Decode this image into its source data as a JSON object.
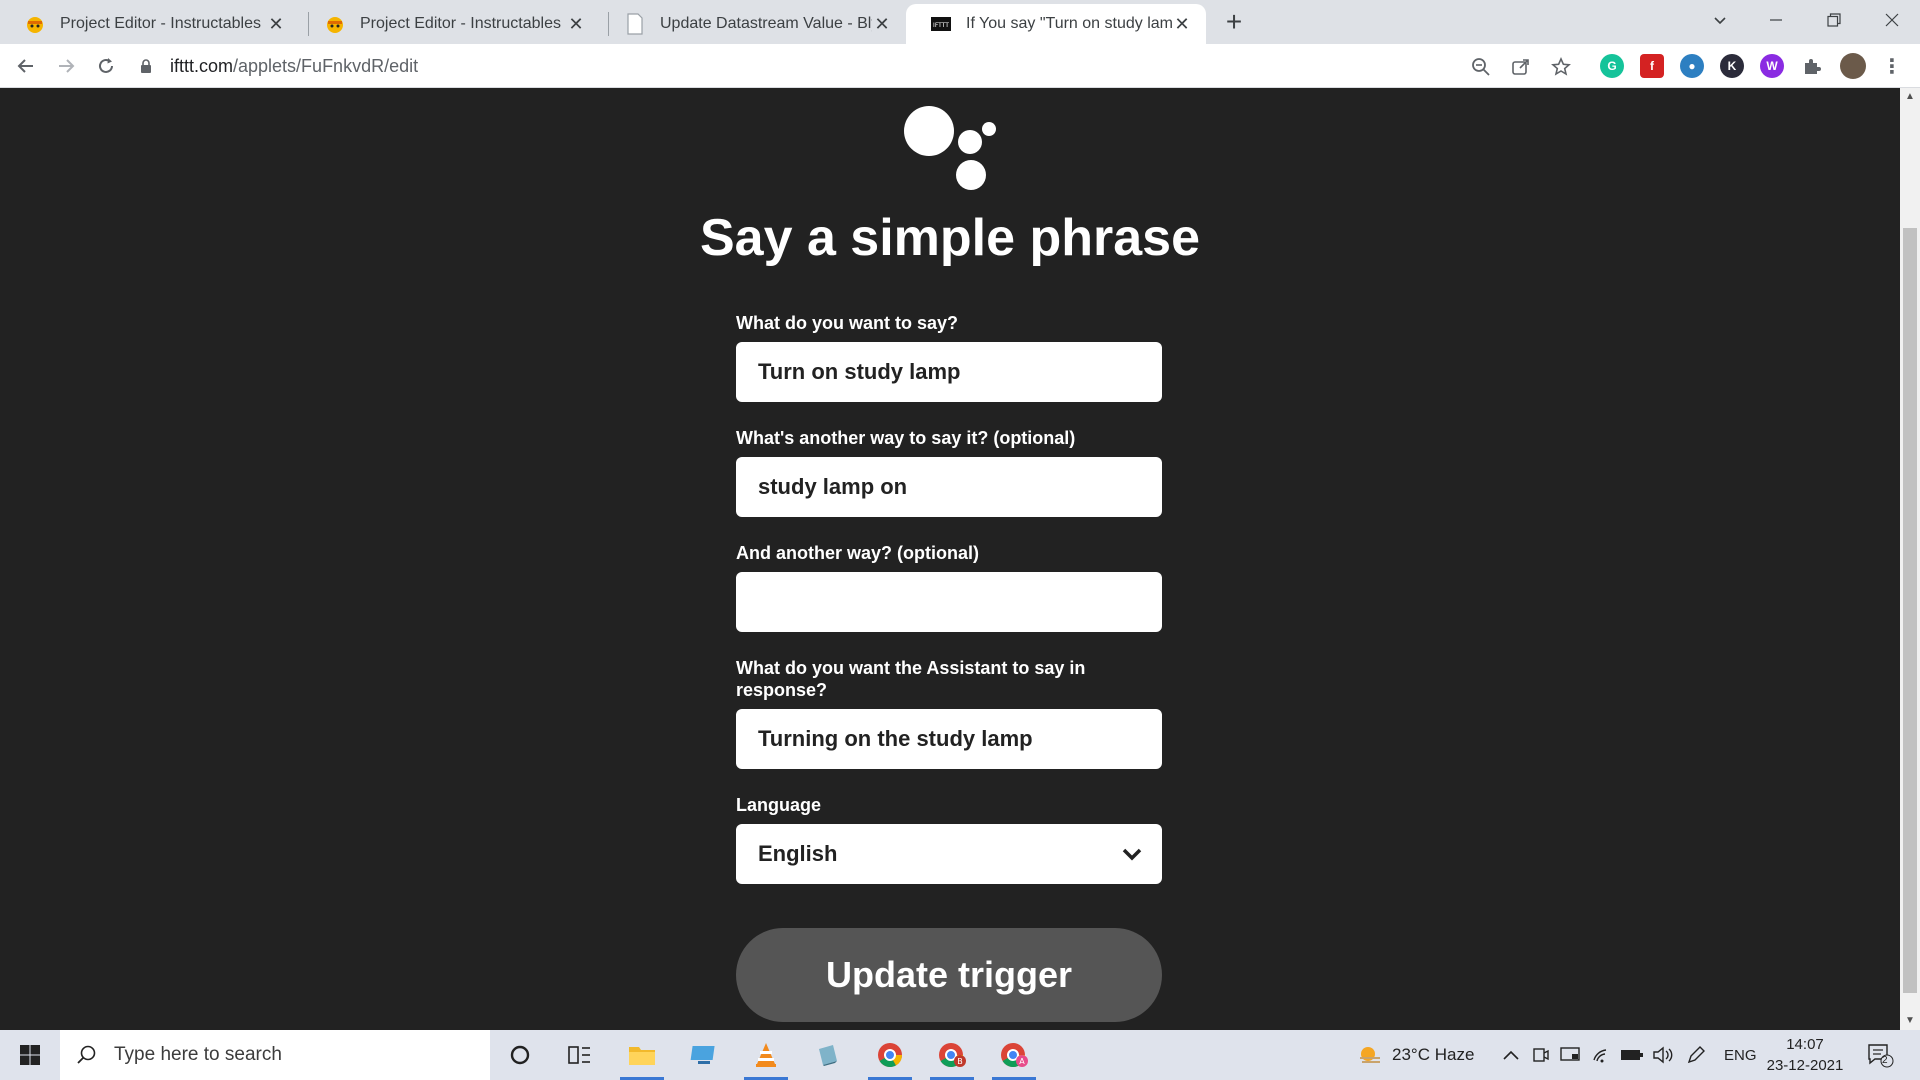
{
  "browser": {
    "tabs": [
      {
        "title": "Project Editor - Instructables",
        "active": false
      },
      {
        "title": "Project Editor - Instructables",
        "active": false
      },
      {
        "title": "Update Datastream Value - Blynk",
        "active": false
      },
      {
        "title": "If You say \"Turn on study lamp\", t",
        "active": true
      }
    ],
    "new_tab_label": "+",
    "url_host": "ifttt.com",
    "url_path": "/applets/FuFnkvdR/edit"
  },
  "page": {
    "heading": "Say a simple phrase",
    "fields": [
      {
        "label": "What do you want to say?",
        "value": "Turn on study lamp"
      },
      {
        "label": "What's another way to say it? (optional)",
        "value": "study lamp on"
      },
      {
        "label": "And another way? (optional)",
        "value": ""
      },
      {
        "label": "What do you want the Assistant to say in response?",
        "value": "Turning on the study lamp"
      }
    ],
    "language": {
      "label": "Language",
      "value": "English"
    },
    "submit_label": "Update trigger"
  },
  "taskbar": {
    "search_placeholder": "Type here to search",
    "weather": "23°C  Haze",
    "language": "ENG",
    "time": "14:07",
    "date": "23-12-2021",
    "notification_count": "2"
  },
  "colors": {
    "page_bg": "#222222",
    "button_bg": "#555555",
    "tabbar_bg": "#dee1e6",
    "taskbar_bg": "#dfe3ec"
  }
}
